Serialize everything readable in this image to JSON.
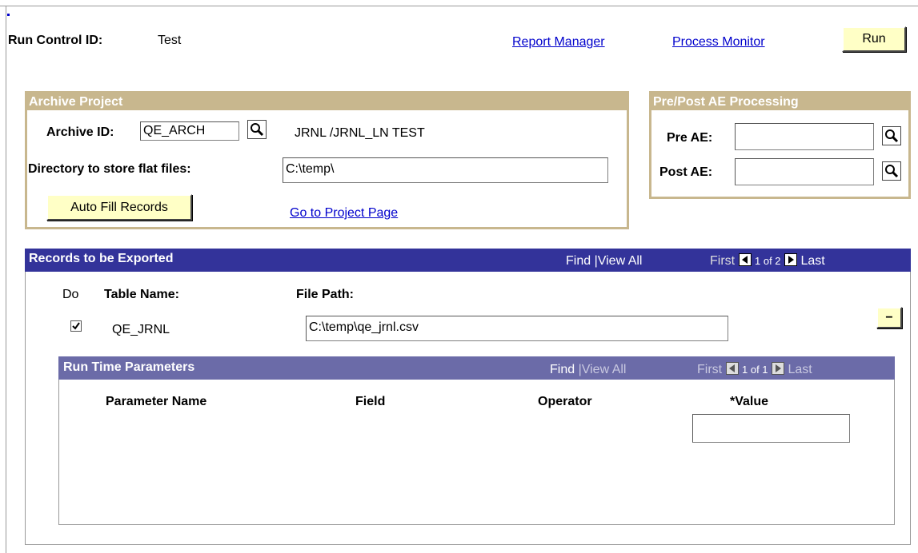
{
  "header": {
    "run_control_label": "Run Control ID:",
    "run_control_value": "Test",
    "report_manager_link": "Report Manager",
    "process_monitor_link": "Process Monitor",
    "run_button": "Run"
  },
  "archive_project": {
    "title": "Archive Project",
    "archive_id_label": "Archive ID:",
    "archive_id_value": "QE_ARCH",
    "archive_desc": "JRNL /JRNL_LN TEST",
    "directory_label": "Directory to store flat files:",
    "directory_value": "C:\\temp\\",
    "auto_fill_button": "Auto Fill Records",
    "go_to_project_link": "Go to Project Page"
  },
  "pre_post": {
    "title": "Pre/Post AE Processing",
    "pre_ae_label": "Pre AE:",
    "pre_ae_value": "",
    "post_ae_label": "Post AE:",
    "post_ae_value": ""
  },
  "records": {
    "title": "Records to be Exported",
    "find_link": "Find",
    "separator": "|",
    "view_all_link": "View All",
    "first_label": "First",
    "page_indicator": "1 of 2",
    "last_link": "Last",
    "col_do": "Do",
    "col_table_name": "Table Name:",
    "col_file_path": "File Path:",
    "row_checked": true,
    "row_table_name": "QE_JRNL",
    "row_file_path": "C:\\temp\\qe_jrnl.csv",
    "remove_button": "−"
  },
  "run_time_params": {
    "title": "Run Time Parameters",
    "find_link": "Find",
    "separator": "|",
    "view_all_label": "View All",
    "first_label": "First",
    "page_indicator": "1 of 1",
    "last_label": "Last",
    "col_parameter_name": "Parameter Name",
    "col_field": "Field",
    "col_operator": "Operator",
    "col_value": "*Value",
    "value_input": ""
  },
  "colors": {
    "tan_header": "#c8b78e",
    "records_header": "#33339a",
    "params_header": "#6b6ba8",
    "button_bg": "#ffffc6",
    "link": "#0000cc"
  },
  "icons": [
    "lookup-icon",
    "prev-arrow-icon",
    "next-arrow-icon",
    "checkbox-icon"
  ]
}
